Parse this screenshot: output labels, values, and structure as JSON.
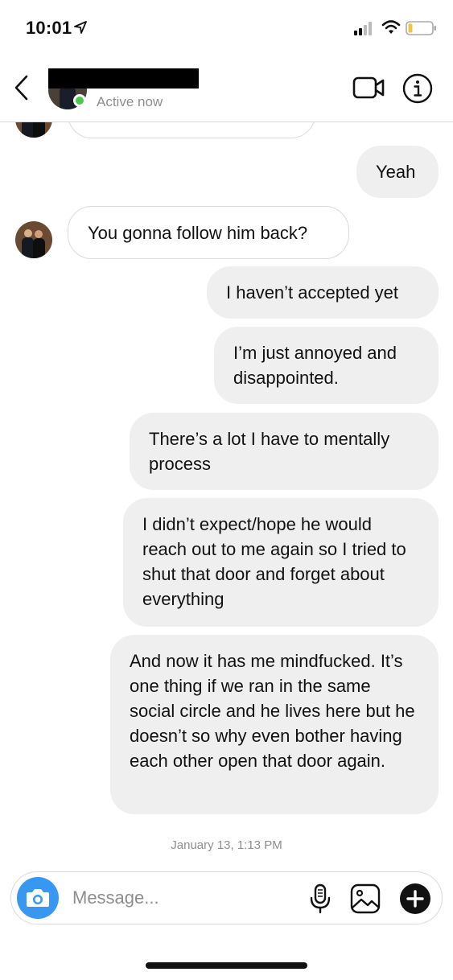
{
  "status_bar": {
    "time": "10:01"
  },
  "header": {
    "active_status": "Active now",
    "active_color": "#4ac951"
  },
  "messages": [
    {
      "side": "received",
      "text": ""
    },
    {
      "side": "sent",
      "text": "Yeah"
    },
    {
      "side": "received",
      "text": "You gonna follow him back?"
    },
    {
      "side": "sent",
      "text": "I haven’t accepted yet"
    },
    {
      "side": "sent",
      "text": "I’m just annoyed and disappointed."
    },
    {
      "side": "sent",
      "text": "There’s a lot I have to mentally process"
    },
    {
      "side": "sent",
      "text": "I didn’t expect/hope he would reach out to me again so I tried to shut that door and forget about everything"
    },
    {
      "side": "sent",
      "text": "And now it has me mindfucked. It’s one thing if we ran in the same social circle and he lives here but he doesn’t so why even bother having each other open that door again."
    }
  ],
  "timestamp": "January 13, 1:13 PM",
  "composer": {
    "placeholder": "Message...",
    "camera_color": "#3897f0"
  },
  "icons": {
    "status": [
      "location-arrow-icon",
      "signal-icon",
      "wifi-icon",
      "battery-icon"
    ],
    "header": [
      "back-chevron-icon",
      "video-call-icon",
      "info-icon"
    ],
    "composer": [
      "camera-icon",
      "microphone-icon",
      "gallery-icon",
      "plus-icon"
    ]
  }
}
